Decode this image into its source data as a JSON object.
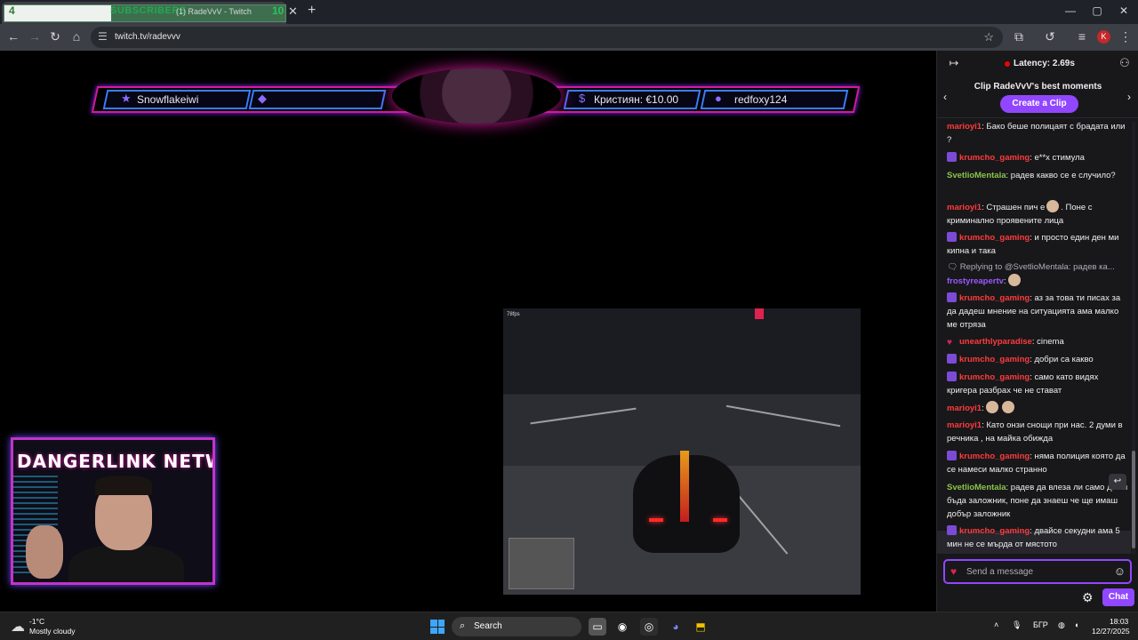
{
  "browser": {
    "tab_overlay_count": "4",
    "tab_overlay_label": "SUBSCRIBERS",
    "tab_title": "(1) RadeVvV - Twitch",
    "tab_overlay_number": "10",
    "url": "twitch.tv/radevvv",
    "profile_initial": "K"
  },
  "stream": {
    "banner": {
      "follower": "Snowflakeiwi",
      "donation": "Кристиян: €10.00",
      "subscriber": "redfoxy124"
    },
    "webcam_title": "DANGERLINK NETWORK",
    "game_fps": "78fps"
  },
  "chat": {
    "latency": "Latency: 2.69s",
    "clip_title": "Clip RadeVvV's best moments",
    "clip_button": "Create a Clip",
    "messages": [
      {
        "user": "marioyi1",
        "text": ": Бако беше полицаят с брадата или ?"
      },
      {
        "user": "krumcho_gaming",
        "text": ": е**х стимула"
      },
      {
        "user": "SvetlioMentala",
        "text": ": радев какво се е случило?"
      },
      {
        "user": "marioyi1",
        "text_a": ": Страшен пич е",
        "text_b": ". Поне с криминално проявените лица"
      },
      {
        "user": "krumcho_gaming",
        "text": ": и просто един ден ми кипна и така"
      },
      {
        "reply": "Replying to @SvetlioMentala: радев ка...",
        "user": "frostyreapertv",
        "text": ":"
      },
      {
        "user": "krumcho_gaming",
        "text": ": аз за това ти писах за да дадеш мнение на ситуацията ама малко ме отряза"
      },
      {
        "user": "unearthlyparadise",
        "text": ": cinema"
      },
      {
        "user": "krumcho_gaming",
        "text": ": добри са какво"
      },
      {
        "user": "krumcho_gaming",
        "text": ": само като видях кригера разбрах че не стават"
      },
      {
        "user": "marioyi1",
        "text": ":"
      },
      {
        "user": "marioyi1",
        "text": ": Като онзи снощи при нас. 2 думи в речника , на майка обижда"
      },
      {
        "user": "krumcho_gaming",
        "text": ": няма полиция която да се намеси малко странно"
      },
      {
        "user": "SvetlioMentala",
        "text": ": радев да влеза ли само да ти бъда заложник, поне да знаеш че ще имаш добър заложник"
      },
      {
        "user": "krumcho_gaming",
        "text": ": двайсе секудни ама 5 мин не се мърда от мястото"
      }
    ],
    "input_placeholder": "Send a message",
    "chat_button": "Chat"
  },
  "taskbar": {
    "temperature": "-1°C",
    "weather": "Mostly cloudy",
    "search_label": "Search",
    "language": "БГР",
    "time": "18:03",
    "date": "12/27/2025"
  },
  "colors": {
    "twitch_purple": "#9147ff",
    "user_red": "#ff3b3b",
    "user_green": "#8bc34a",
    "user_violet": "#9b59ff"
  }
}
